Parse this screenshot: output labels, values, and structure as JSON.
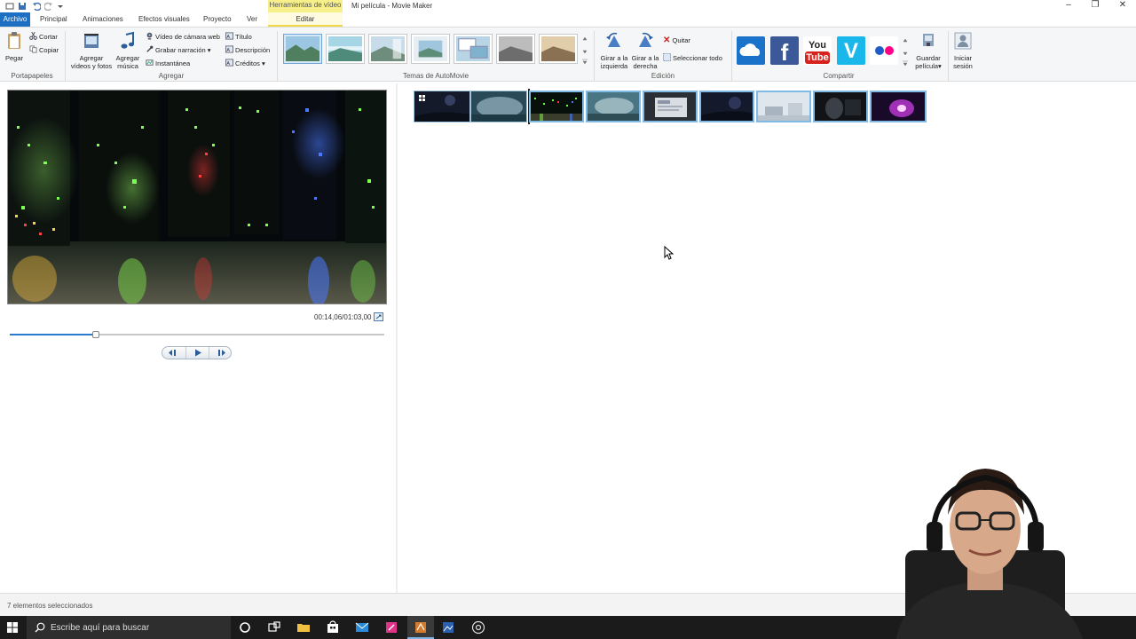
{
  "titlebar": {
    "window_title": "Mi película - Movie Maker",
    "context_tab_header": "Herramientas de vídeo",
    "quick_access_icons": [
      "menu-icon",
      "save-icon",
      "undo-icon",
      "redo-icon",
      "dropdown-icon"
    ]
  },
  "tabs": [
    {
      "label": "Archivo",
      "active": false
    },
    {
      "label": "Principal",
      "active": true
    },
    {
      "label": "Animaciones",
      "active": false
    },
    {
      "label": "Efectos visuales",
      "active": false
    },
    {
      "label": "Proyecto",
      "active": false
    },
    {
      "label": "Ver",
      "active": false
    },
    {
      "label": "Editar",
      "active": false
    }
  ],
  "ribbon": {
    "portapapeles": {
      "label": "Portapapeles",
      "paste": "Pegar",
      "cut": "Cortar",
      "copy": "Copiar"
    },
    "agregar": {
      "label": "Agregar",
      "add_videos_line1": "Agregar",
      "add_videos_line2": "vídeos y fotos",
      "add_music_line1": "Agregar",
      "add_music_line2": "música",
      "webcam_video": "Vídeo de cámara web",
      "record_narration": "Grabar narración",
      "snapshot": "Instantánea",
      "title": "Título",
      "caption": "Descripción",
      "credits": "Créditos"
    },
    "temas": {
      "label": "Temas de AutoMovie",
      "selected_index": 0
    },
    "edicion": {
      "label": "Edición",
      "rotate_left_line1": "Girar a la",
      "rotate_left_line2": "izquierda",
      "rotate_right_line1": "Girar a la",
      "rotate_right_line2": "derecha",
      "remove": "Quitar",
      "select_all": "Seleccionar todo"
    },
    "compartir": {
      "label": "Compartir",
      "services": [
        "onedrive-icon",
        "facebook-icon",
        "youtube-icon",
        "vimeo-icon",
        "flickr-icon"
      ],
      "youtube_text_1": "You",
      "youtube_text_2": "Tube",
      "save_movie_line1": "Guardar",
      "save_movie_line2": "película",
      "sign_in_line1": "Iniciar",
      "sign_in_line2": "sesión"
    }
  },
  "preview": {
    "time_readout": "00:14,06/01:03,00",
    "progress_fraction": 0.23
  },
  "storyboard": {
    "clip_count": 9,
    "selected_count": 7
  },
  "status": {
    "text": "7 elementos seleccionados"
  },
  "taskbar": {
    "search_placeholder": "Escribe aquí para buscar"
  },
  "colors": {
    "accent": "#1c6fc2",
    "context_tab": "#f7ef8a",
    "seek_fill": "#2a7ad0"
  }
}
